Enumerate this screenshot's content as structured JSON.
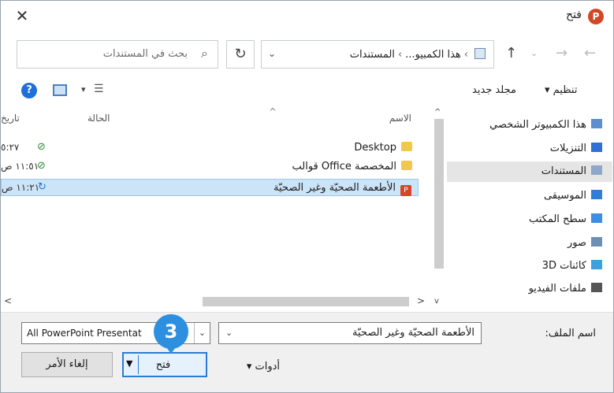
{
  "window": {
    "title": "فتح",
    "app_icon_letter": "P",
    "close_glyph": "✕"
  },
  "address": {
    "path": [
      "هذا الكمبيو...",
      "المستندات"
    ],
    "search_placeholder": "بحث في المستندات"
  },
  "toolbar": {
    "organize_label": "تنظيم ▾",
    "new_folder_label": "مجلد جديد",
    "help_glyph": "?"
  },
  "columns": {
    "name": "الاسم",
    "status": "الحالة",
    "date": "تاريخ"
  },
  "files": [
    {
      "name": "Desktop",
      "type": "folder",
      "status": "synced",
      "status_glyph": "⊘",
      "date": "٥:٢٧"
    },
    {
      "name": "المخصصة Office قوالب",
      "type": "folder",
      "status": "synced",
      "status_glyph": "⊘",
      "date": "١١:٥١ ص"
    },
    {
      "name": "الأطعمة الصحيّة وغير الصحيّة",
      "type": "pptx",
      "status": "syncing",
      "status_glyph": "↻",
      "date": "١١:٢١ ص"
    }
  ],
  "nav": [
    {
      "label": "هذا الكمبيوتر الشخصي",
      "icon": "computer-icon",
      "color": "#5b8fd0"
    },
    {
      "label": "التنزيلات",
      "icon": "download-icon",
      "color": "#2f6fd8"
    },
    {
      "label": "المستندات",
      "icon": "documents-icon",
      "color": "#8fa7c9",
      "selected": true
    },
    {
      "label": "الموسيقى",
      "icon": "music-icon",
      "color": "#2f7fd8"
    },
    {
      "label": "سطح المكتب",
      "icon": "desktop-icon",
      "color": "#3a8ee6"
    },
    {
      "label": "صور",
      "icon": "pictures-icon",
      "color": "#6b8fb5"
    },
    {
      "label": "كائنات 3D",
      "icon": "3d-objects-icon",
      "color": "#3aa0e0"
    },
    {
      "label": "ملفات الفيديو",
      "icon": "video-icon",
      "color": "#555"
    }
  ],
  "bottom": {
    "filename_label": "اسم الملف:",
    "filename_value": "الأطعمة الصحيّة وغير الصحيّة",
    "filter_value": "All PowerPoint Presentat",
    "tools_label": "أدوات ▾",
    "open_label": "فتح",
    "cancel_label": "إلغاء الأمر",
    "step_number": "3"
  },
  "colors": {
    "selection": "#cce4f7",
    "accent": "#2d7ad6",
    "badge": "#2d8fe0"
  }
}
